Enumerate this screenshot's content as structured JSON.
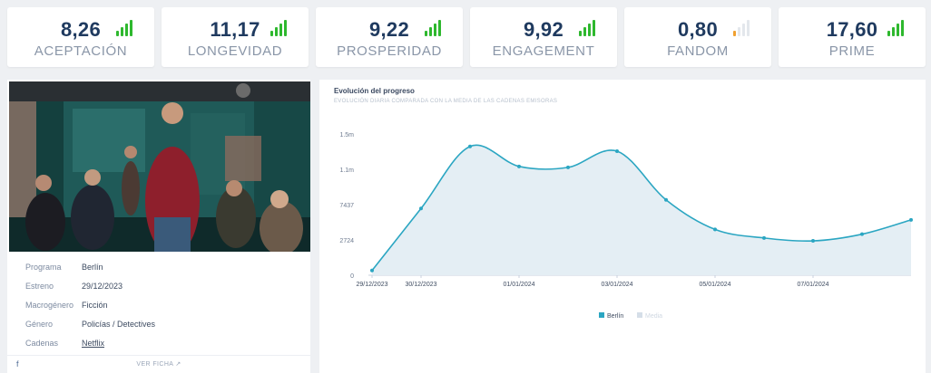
{
  "kpis": [
    {
      "value": "8,26",
      "label": "ACEPTACIÓN",
      "signal": 4,
      "color": "#2eb82e"
    },
    {
      "value": "11,17",
      "label": "LONGEVIDAD",
      "signal": 4,
      "color": "#2eb82e"
    },
    {
      "value": "9,22",
      "label": "PROSPERIDAD",
      "signal": 4,
      "color": "#2eb82e"
    },
    {
      "value": "9,92",
      "label": "ENGAGEMENT",
      "signal": 4,
      "color": "#2eb82e"
    },
    {
      "value": "0,80",
      "label": "FANDOM",
      "signal": 1,
      "color": "#f0a030"
    },
    {
      "value": "17,60",
      "label": "PRIME",
      "signal": 4,
      "color": "#2eb82e"
    }
  ],
  "program": {
    "rows": [
      {
        "key": "Programa",
        "value": "Berlín"
      },
      {
        "key": "Estreno",
        "value": "29/12/2023"
      },
      {
        "key": "Macrogénero",
        "value": "Ficción"
      },
      {
        "key": "Género",
        "value": "Policías / Detectives"
      },
      {
        "key": "Cadenas",
        "value": "Netflix"
      }
    ],
    "footer_link": "VER FICHA",
    "facebook": "f"
  },
  "chart_title": "Evolución del progreso",
  "chart_subtitle": "EVOLUCIÓN DIARIA COMPARADA CON LA MEDIA DE LAS CADENAS EMISORAS",
  "chart_data": {
    "type": "area",
    "yticks": [
      "0",
      "2724",
      "7437",
      "1.1m",
      "1.5m"
    ],
    "ytick_values": [
      0,
      370000,
      740000,
      1110000,
      1480000
    ],
    "ylim": [
      0,
      1480000
    ],
    "xticks": [
      "29/12/2023",
      "30/12/2023",
      "01/01/2024",
      "03/01/2024",
      "05/01/2024",
      "07/01/2024"
    ],
    "x": [
      "29/12/2023",
      "30/12/2023",
      "31/12/2023",
      "01/01/2024",
      "02/01/2024",
      "03/01/2024",
      "04/01/2024",
      "05/01/2024",
      "06/01/2024",
      "07/01/2024",
      "08/01/2024",
      "09/01/2024"
    ],
    "series": [
      {
        "name": "Berlín",
        "values": [
          50000,
          700000,
          1350000,
          1140000,
          1130000,
          1300000,
          790000,
          480000,
          390000,
          360000,
          430000,
          580000
        ],
        "color": "#2ba6c2"
      },
      {
        "name": "Media",
        "values": [],
        "color": "#d5dee8"
      }
    ],
    "legend": "bottom-center",
    "grid": false
  }
}
